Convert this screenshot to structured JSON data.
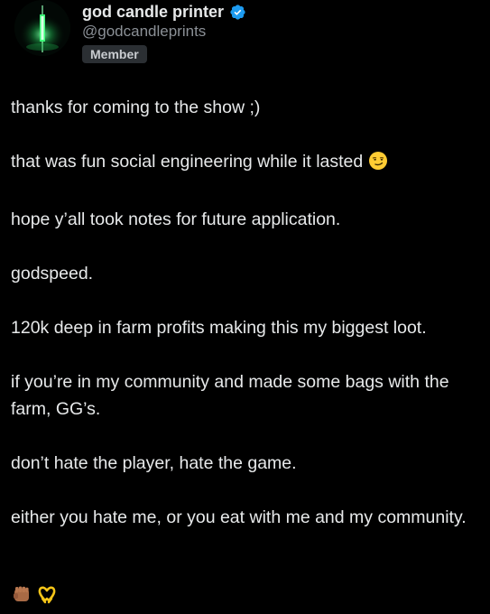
{
  "profile": {
    "display_name": "god candle printer",
    "handle": "@godcandleprints",
    "badge": "Member",
    "avatar_icon": "green-candle-icon",
    "verified_icon": "verified-badge-icon",
    "verified_color": "#1d9bf0"
  },
  "post": {
    "paragraphs": [
      "thanks for coming to the show ;)",
      "that was fun social engineering while it lasted",
      "hope y’all took notes for future application.",
      "godspeed.",
      "120k deep in farm profits making this my biggest loot.",
      "if you’re in my community and made some bags with the farm, GG’s.",
      "don’t hate the player, hate the game.",
      "either you hate me, or you eat with me and my community."
    ],
    "smirk_emoji_icon": "smirking-face-icon",
    "trailing_emojis": [
      "raised-fist-icon",
      "heart-hands-icon"
    ]
  },
  "colors": {
    "background": "#000000",
    "text": "#e7e9ea",
    "secondary_text": "#8b9096",
    "badge_bg": "#2b2f33"
  }
}
